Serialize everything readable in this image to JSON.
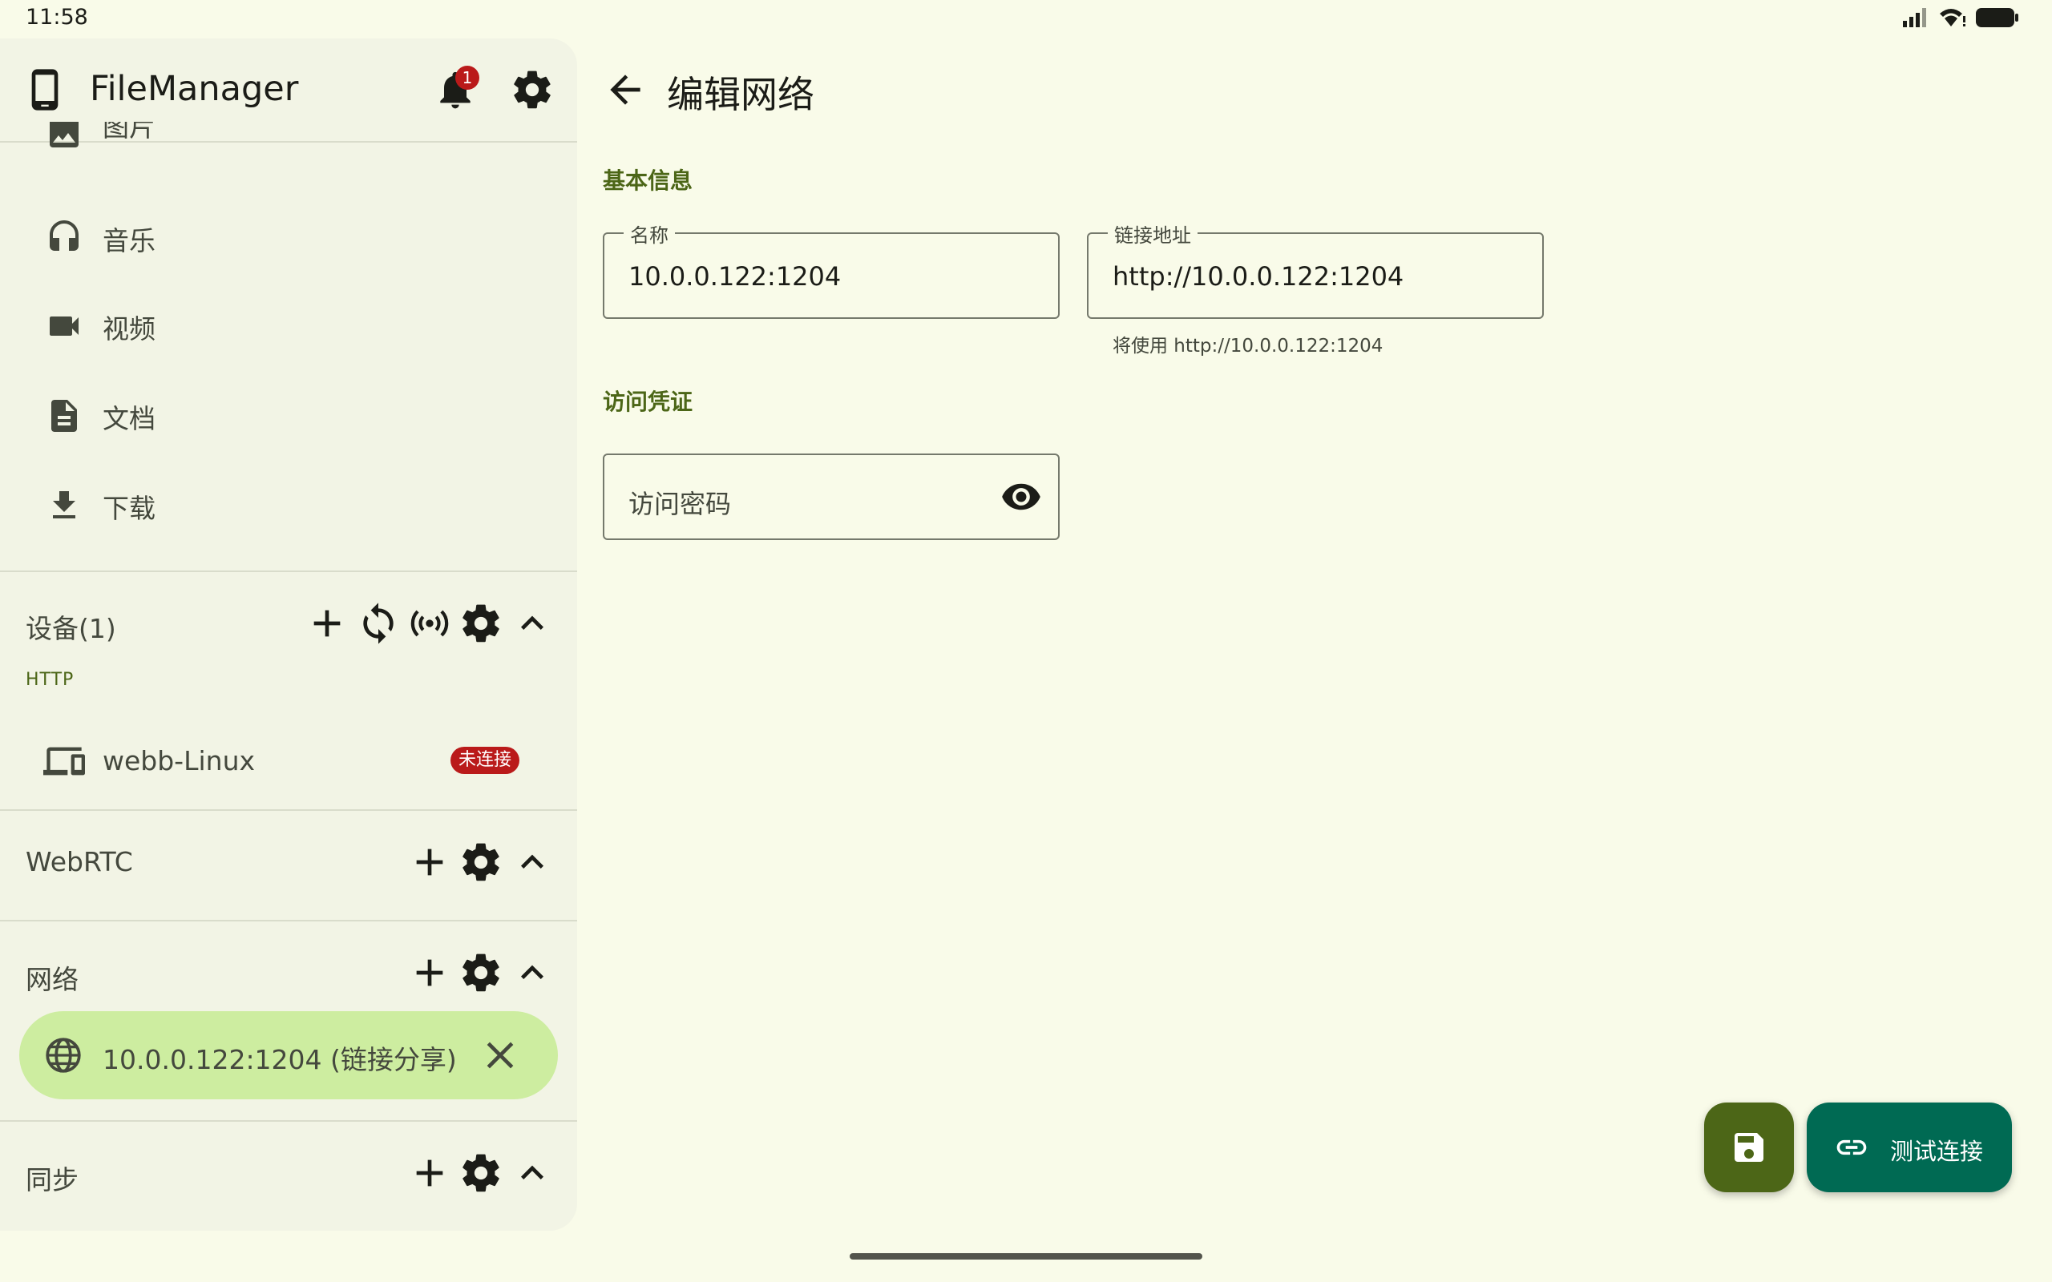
{
  "status_bar": {
    "time": "11:58"
  },
  "drawer": {
    "app_title": "FileManager",
    "notification_count": "1",
    "nav_items": [
      {
        "label": "图片",
        "icon": "image-icon"
      },
      {
        "label": "音乐",
        "icon": "headphones-icon"
      },
      {
        "label": "视频",
        "icon": "video-icon"
      },
      {
        "label": "文档",
        "icon": "document-icon"
      },
      {
        "label": "下载",
        "icon": "download-icon"
      }
    ],
    "devices": {
      "title": "设备(1)",
      "sub_label": "HTTP",
      "item": {
        "label": "webb-Linux",
        "badge": "未连接"
      }
    },
    "webrtc": {
      "title": "WebRTC"
    },
    "network": {
      "title": "网络",
      "item": {
        "label": "10.0.0.122:1204 (链接分享)"
      }
    },
    "sync": {
      "title": "同步"
    }
  },
  "main": {
    "title": "编辑网络",
    "basic_info_title": "基本信息",
    "name_field": {
      "label": "名称",
      "value": "10.0.0.122:1204"
    },
    "url_field": {
      "label": "链接地址",
      "value": "http://10.0.0.122:1204",
      "support": "将使用 http://10.0.0.122:1204"
    },
    "credentials_title": "访问凭证",
    "password_field": {
      "placeholder": "访问密码"
    }
  },
  "fabs": {
    "test_label": "测试连接"
  },
  "colors": {
    "background": "#f9fbe9",
    "drawer": "#f2f4e5",
    "primary": "#4c6617",
    "selected_item": "#cdeda0",
    "error": "#ba1a1a",
    "tertiary": "#006a53"
  }
}
